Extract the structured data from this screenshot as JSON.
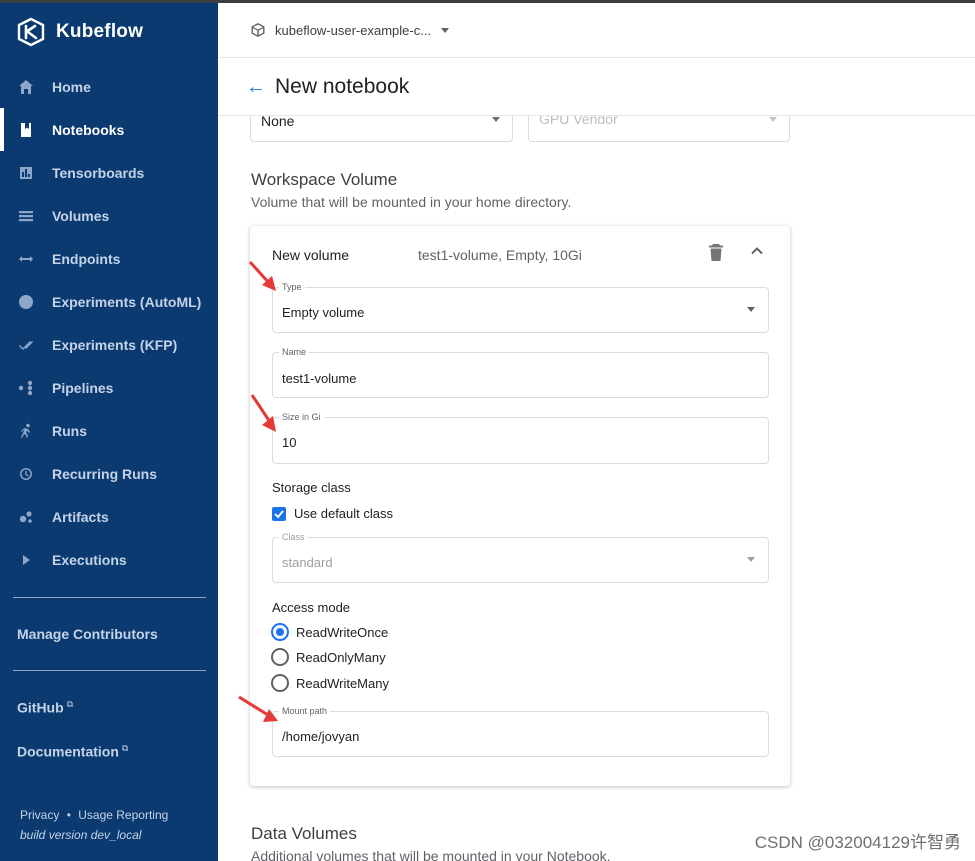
{
  "app": {
    "name": "Kubeflow",
    "namespace": "kubeflow-user-example-c..."
  },
  "sidebar": {
    "items": [
      {
        "label": "Home",
        "icon": "home-icon"
      },
      {
        "label": "Notebooks",
        "icon": "notebook-icon",
        "active": true
      },
      {
        "label": "Tensorboards",
        "icon": "chart-icon"
      },
      {
        "label": "Volumes",
        "icon": "list-icon"
      },
      {
        "label": "Endpoints",
        "icon": "arrows-icon"
      },
      {
        "label": "Experiments (AutoML)",
        "icon": "compass-icon"
      },
      {
        "label": "Experiments (KFP)",
        "icon": "check-icon"
      },
      {
        "label": "Pipelines",
        "icon": "pipeline-icon"
      },
      {
        "label": "Runs",
        "icon": "run-icon"
      },
      {
        "label": "Recurring Runs",
        "icon": "clock-icon"
      },
      {
        "label": "Artifacts",
        "icon": "bubbles-icon"
      },
      {
        "label": "Executions",
        "icon": "play-icon"
      }
    ],
    "manage_contributors": "Manage Contributors",
    "github": "GitHub",
    "documentation": "Documentation",
    "external_mark": "⧉",
    "privacy": "Privacy",
    "dot": "•",
    "usage": "Usage Reporting",
    "build": "build version dev_local"
  },
  "page": {
    "back_arrow": "←",
    "title": "New notebook"
  },
  "top_fields": {
    "gpu_number": "None",
    "gpu_vendor": "GPU Vendor"
  },
  "workspace": {
    "title": "Workspace Volume",
    "subtitle": "Volume that will be mounted in your home directory.",
    "card": {
      "name": "New volume",
      "summary": "test1-volume, Empty, 10Gi",
      "type_label": "Type",
      "type_value": "Empty volume",
      "name_label": "Name",
      "name_value": "test1-volume",
      "size_label": "Size in Gi",
      "size_value": "10",
      "storage_class_label": "Storage class",
      "use_default_class": "Use default class",
      "class_label": "Class",
      "class_value": "standard",
      "access_mode_label": "Access mode",
      "access_modes": [
        "ReadWriteOnce",
        "ReadOnlyMany",
        "ReadWriteMany"
      ],
      "access_selected": "ReadWriteOnce",
      "mount_label": "Mount path",
      "mount_value": "/home/jovyan"
    }
  },
  "data_volumes": {
    "title": "Data Volumes",
    "subtitle": "Additional volumes that will be mounted in your Notebook."
  },
  "watermark": "CSDN @032004129许智勇",
  "colors": {
    "sidebar": "#0a3a70",
    "accent": "#1a73e8",
    "annotation": "#e53935"
  }
}
